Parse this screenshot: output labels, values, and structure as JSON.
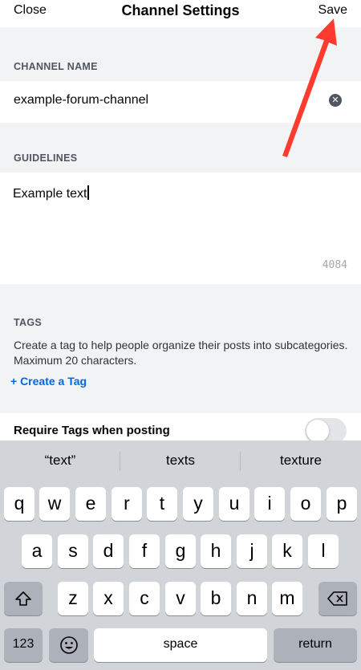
{
  "header": {
    "close_label": "Close",
    "title": "Channel Settings",
    "save_label": "Save"
  },
  "channel_name": {
    "label": "CHANNEL NAME",
    "value": "example-forum-channel",
    "clear_icon": "clear-circle-icon"
  },
  "guidelines": {
    "label": "GUIDELINES",
    "value": "Example text",
    "remaining": "4084"
  },
  "tags": {
    "label": "TAGS",
    "description": "Create a tag to help people organize their posts into subcategories. Maximum 20 characters.",
    "create_link": "+ Create a Tag"
  },
  "require_tags": {
    "label": "Require Tags when posting",
    "enabled": false
  },
  "annotation": {
    "arrow_color": "#ff3b30",
    "points_to": "Save"
  },
  "keyboard": {
    "suggestions": [
      "“text”",
      "texts",
      "texture"
    ],
    "row1": [
      "q",
      "w",
      "e",
      "r",
      "t",
      "y",
      "u",
      "i",
      "o",
      "p"
    ],
    "row2": [
      "a",
      "s",
      "d",
      "f",
      "g",
      "h",
      "j",
      "k",
      "l"
    ],
    "row3": [
      "z",
      "x",
      "c",
      "v",
      "b",
      "n",
      "m"
    ],
    "shift_icon": "shift-icon",
    "backspace_icon": "backspace-icon",
    "numbers_label": "123",
    "emoji_icon": "emoji-icon",
    "space_label": "space",
    "return_label": "return"
  }
}
